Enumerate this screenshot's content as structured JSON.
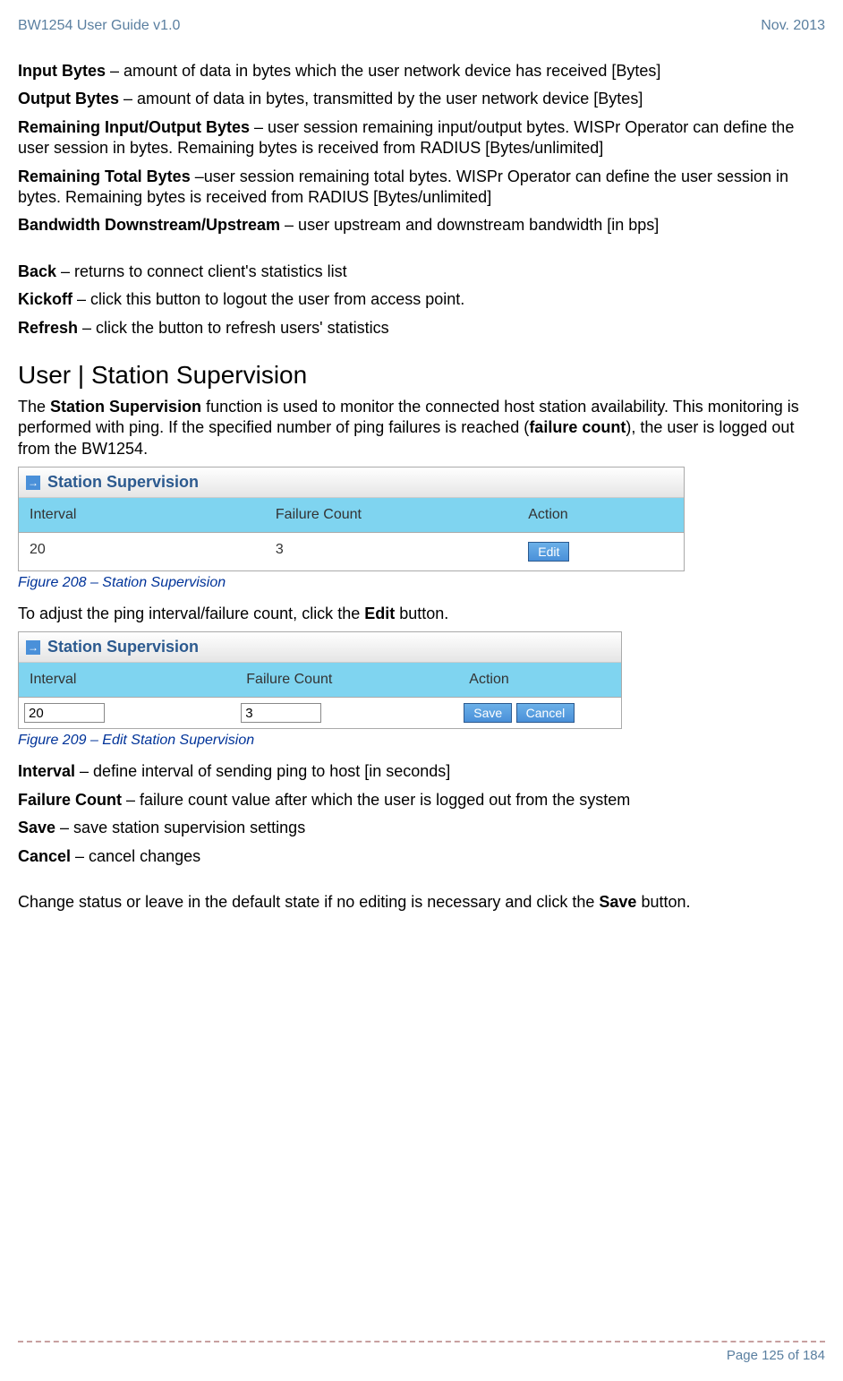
{
  "header": {
    "left": "BW1254 User Guide v1.0",
    "right": "Nov.  2013"
  },
  "defs": [
    {
      "term": "Input Bytes",
      "text": " – amount of data in bytes which the user network device has received [Bytes]"
    },
    {
      "term": "Output Bytes",
      "text": " – amount of data in bytes, transmitted by the user network device [Bytes]"
    },
    {
      "term": "Remaining Input/Output Bytes",
      "text": " – user session remaining input/output bytes. WISPr Operator can define the user session in bytes. Remaining bytes is received from RADIUS [Bytes/unlimited]"
    },
    {
      "term": "Remaining Total Bytes",
      "text": " –user session remaining total bytes. WISPr Operator can define the user session in bytes. Remaining bytes is received from RADIUS [Bytes/unlimited]"
    },
    {
      "term": "Bandwidth Downstream/Upstream",
      "text": " – user upstream and downstream bandwidth [in bps]"
    }
  ],
  "defs2": [
    {
      "term": "Back",
      "text": " – returns to connect client's statistics list"
    },
    {
      "term": "Kickoff",
      "text": " – click this button to logout the user from access point."
    },
    {
      "term": "Refresh",
      "text": " – click the button to refresh users' statistics"
    }
  ],
  "section_heading": "User | Station Supervision",
  "intro_parts": {
    "p1": "The ",
    "b1": "Station Supervision",
    "p2": " function is used to monitor the connected host station availability. This monitoring is performed with ping. If the specified number of ping failures is reached (",
    "b2": "failure count",
    "p3": "), the user is logged out from the BW1254."
  },
  "table1": {
    "title": "Station Supervision",
    "cols": {
      "c1": "Interval",
      "c2": "Failure Count",
      "c3": "Action"
    },
    "row": {
      "c1": "20",
      "c2": "3",
      "btn": "Edit"
    }
  },
  "caption1": "Figure 208 – Station Supervision",
  "adjust_parts": {
    "p1": "To adjust the ping interval/failure count, click the ",
    "b1": "Edit",
    "p2": " button."
  },
  "table2": {
    "title": "Station Supervision",
    "cols": {
      "c1": "Interval",
      "c2": "Failure Count",
      "c3": "Action"
    },
    "row": {
      "c1": "20",
      "c2": "3",
      "btn1": "Save",
      "btn2": "Cancel"
    }
  },
  "caption2": "Figure 209 – Edit Station Supervision",
  "defs3": [
    {
      "term": "Interval",
      "text": " – define interval of sending ping to host [in seconds]"
    },
    {
      "term": "Failure Count",
      "text": " – failure count value after which the user is logged out from the system"
    },
    {
      "term": "Save",
      "text": " – save station supervision settings"
    },
    {
      "term": "Cancel",
      "text": " – cancel changes"
    }
  ],
  "closing_parts": {
    "p1": "Change status or leave in the default state if no editing is necessary and click the ",
    "b1": "Save",
    "p2": " button."
  },
  "footer": {
    "page": "Page 125 of 184"
  }
}
